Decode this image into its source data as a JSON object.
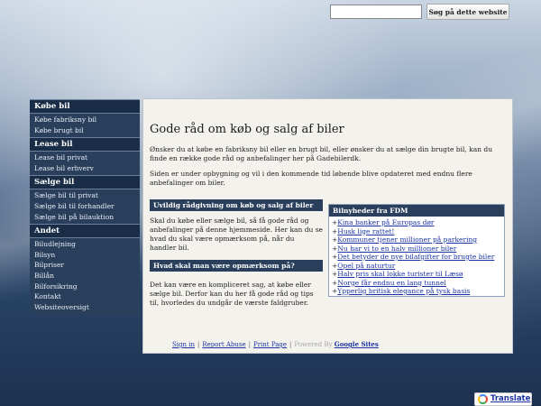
{
  "search": {
    "placeholder": "",
    "button_label": "Søg på dette website"
  },
  "sidebar": {
    "groups": [
      {
        "title": "Købe bil",
        "items": [
          "Købe fabriksny bil",
          "Købe brugt bil"
        ]
      },
      {
        "title": "Lease bil",
        "items": [
          "Lease bil privat",
          "Lease bil erhverv"
        ]
      },
      {
        "title": "Sælge bil",
        "items": [
          "Sælge bil til privat",
          "Sælge bil til forhandler",
          "Sælge bil på bilauktion"
        ]
      },
      {
        "title": "Andet",
        "items": [
          "Biludlejning",
          "Bilsyn",
          "Bilpriser",
          "Billån",
          "Bilforsikring",
          "Kontakt",
          "Websiteoversigt"
        ]
      }
    ]
  },
  "main": {
    "title": "Gode råd om køb og salg af biler",
    "intro": "Ønsker du at købe en fabriksny bil eller en brugt bil, eller ønsker du at sælge din brugte bil, kan du finde en række gode råd og anbefalinger her på Gadebilerdk.",
    "intro2": "Siden er under opbygning og vil i den kommende tid løbende blive opdateret med endnu flere anbefalinger om biler.",
    "section1": {
      "heading": "Uvildig rådgivning om køb og salg af biler",
      "text": "Skal du købe eller sælge bil, så få gode råd og anbefalinger på denne hjemmeside. Her kan du se hvad du skal være opmærksom på, når du handler bil."
    },
    "section2": {
      "heading": "Hvad skal man være opmærksom på?",
      "text": "Det kan være en kompliceret sag, at købe eller sælge bil. Derfor kan du her få gode råd og tips til, hvorledes du undgår de værste faldgruber."
    },
    "news": {
      "heading": "Bilnyheder fra FDM",
      "items": [
        "Kina banker på Europas dør",
        "Husk lige rattet!",
        "Kommuner tjener millioner på parkering",
        "Nu har vi to en halv millioner biler",
        "Det betyder de nye bilafgifter for brugte biler",
        "Opel på naturtur",
        "Halv pris skal lokke turister til Læsø",
        "Norge får endnu en lang tunnel",
        "Ypperlig britisk elegance på tysk basis"
      ]
    }
  },
  "footer": {
    "sign_in": "Sign in",
    "report_abuse": "Report Abuse",
    "print_page": "Print Page",
    "powered_by": "Powered By",
    "google_sites": "Google Sites",
    "separator": "|"
  },
  "translate": {
    "label": "Translate"
  }
}
